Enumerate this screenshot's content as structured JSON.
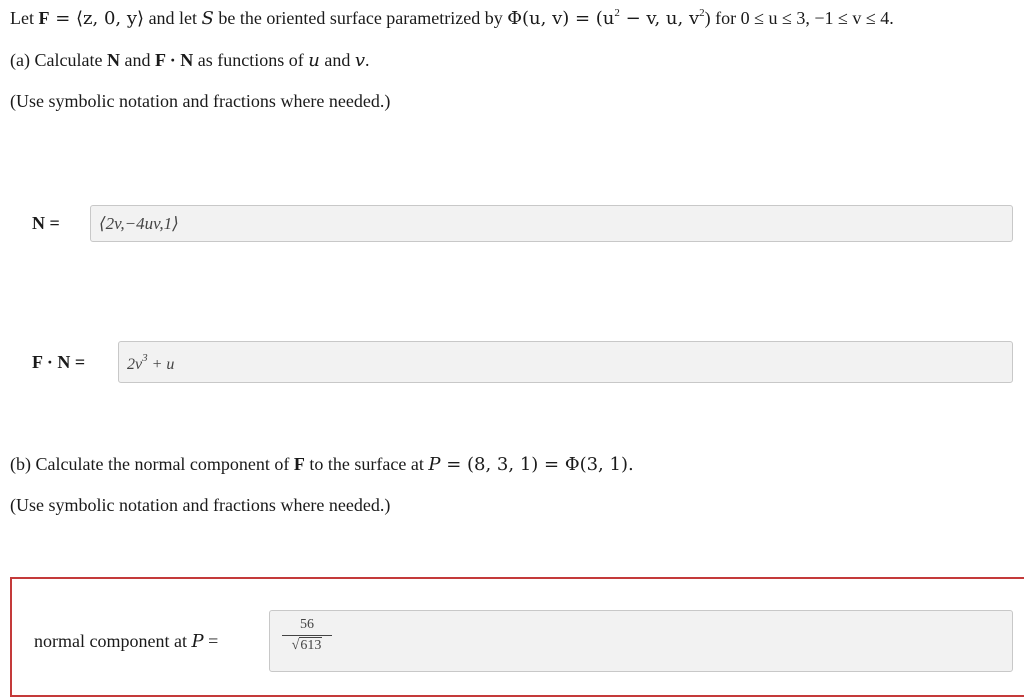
{
  "problem": {
    "intro": "Let F = ⟨z, 0, y⟩ and let S be the oriented surface parametrized by Φ(u, v) = (u² − v, u, v²) for 0 ≤ u ≤ 3, −1 ≤ v ≤ 4.",
    "intro_parts": {
      "let": "Let ",
      "F": "F",
      "eq_vec": " = ⟨z, 0, y⟩",
      "and_let": " and let ",
      "S": "S",
      "surface_text": " be the oriented surface parametrized by ",
      "phi": "Φ(u, v) = (u",
      "sup2a": "2",
      "mid": " − v, u, v",
      "sup2b": "2",
      "close": ") for 0 ≤ u ≤ 3, −1 ≤ v ≤ 4."
    },
    "part_a_prompt": "(a) Calculate N and F · N as functions of u and v.",
    "part_a_parts": {
      "pre": "(a) Calculate ",
      "N": "N",
      "and": " and ",
      "FN": "F · N",
      "as": " as functions of ",
      "u": "u",
      "and2": " and ",
      "v": "v",
      "dot": "."
    },
    "hint": "(Use symbolic notation and fractions where needed.)",
    "part_b_prompt": "(b) Calculate the normal component of F to the surface at P = (8, 3, 1) = Φ(3, 1).",
    "part_b_parts": {
      "pre": "(b) Calculate the normal component of ",
      "F": "F",
      "mid": " to the surface at ",
      "P": "P",
      "rest": " = (8, 3, 1) = Φ(3, 1)."
    }
  },
  "answers": {
    "N_label": "N =",
    "N_value": "⟨2v,−4uv,1⟩",
    "FN_label": "F · N =",
    "FN_value_base": "2v",
    "FN_value_exp": "3",
    "FN_value_tail": " + u",
    "normal_label_pre": "normal component at ",
    "normal_label_P": "P",
    "normal_label_eq": " =",
    "normal_num": "56",
    "normal_den_sqrt": "√",
    "normal_den": "613"
  },
  "colors": {
    "feedback_border": "#c43a3a",
    "field_bg": "#f2f2f2"
  }
}
